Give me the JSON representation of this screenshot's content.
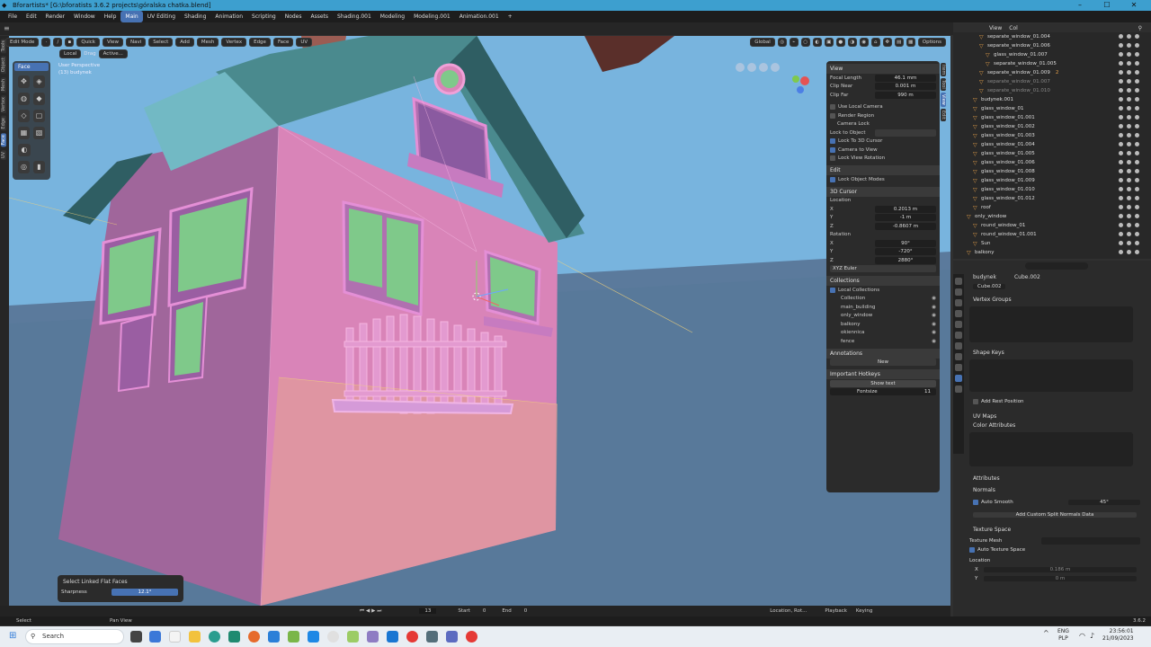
{
  "title_bar": {
    "title": "Bforartists* [G:\\bforatists 3.6.2 projects\\góralska chatka.blend]",
    "minimize": "–",
    "maximize": "☐",
    "close": "✕"
  },
  "menu": {
    "items": [
      "File",
      "Edit",
      "Render",
      "Window",
      "Help"
    ],
    "workspaces": [
      "Main",
      "UV Editing",
      "Shading",
      "Animation",
      "Scripting",
      "Nodes",
      "Assets",
      "Shading.001",
      "Modeling",
      "Modeling.001",
      "Animation.001"
    ],
    "active_workspace": "Main",
    "add_tab": "+"
  },
  "viewport_header": {
    "mode": "Edit Mode",
    "transform_space": "Local",
    "drag": "Drag",
    "active": "Active...",
    "menus": [
      "Quick",
      "View",
      "Navi",
      "Select",
      "Add",
      "Mesh",
      "Vertex",
      "Edge",
      "Face",
      "UV"
    ],
    "orientation": "Global",
    "options": "Options"
  },
  "viewport": {
    "perspective": "User Perspective",
    "object_label": "(13) budynek"
  },
  "left_tabs": [
    "Tools",
    "Object",
    "Mesh",
    "Vertex",
    "Edge",
    "Face",
    "UV"
  ],
  "active_left_tab": "Face",
  "toolbar": {
    "header": "Face"
  },
  "sidebar": {
    "view_header": "View",
    "focal_length_label": "Focal Length",
    "focal_length": "46.1 mm",
    "clip_near_label": "Clip Near",
    "clip_near": "0.001 m",
    "clip_far_label": "Clip Far",
    "clip_far": "990 m",
    "use_local_camera": "Use Local Camera",
    "render_region": "Render Region",
    "camera_lock": "Camera Lock",
    "lock_to_object": "Lock to Object",
    "lock_3d_cursor": "Lock To 3D Cursor",
    "camera_to_view": "Camera to View",
    "lock_view_rotation": "Lock View Rotation",
    "edit_header": "Edit",
    "lock_object_modes": "Lock Object Modes",
    "cursor_header": "3D Cursor",
    "location_label": "Location",
    "loc": [
      {
        "axis": "X",
        "value": "0.2013 m"
      },
      {
        "axis": "Y",
        "value": "-1 m"
      },
      {
        "axis": "Z",
        "value": "-0.8607 m"
      }
    ],
    "rotation_label": "Rotation",
    "rot": [
      {
        "axis": "X",
        "value": "90°"
      },
      {
        "axis": "Y",
        "value": "-720°"
      },
      {
        "axis": "Z",
        "value": "2880°"
      }
    ],
    "rotation_mode": "XYZ Euler",
    "collections_header": "Collections",
    "local_collections": "Local Collections",
    "collections": [
      "Collection",
      "main_building",
      "only_window",
      "balkony",
      "okiennica",
      "fence"
    ],
    "annotations_header": "Annotations",
    "annotations_new": "New",
    "hotkeys_header": "Important Hotkeys",
    "show_text": "Show text",
    "fontsize_label": "Fontsize",
    "fontsize": "11"
  },
  "right_tabs": [
    "Item",
    "Tool",
    "View",
    "Edit"
  ],
  "active_right_tab": "View",
  "outliner": {
    "header_view": "View",
    "header_col": "Col",
    "rows": [
      {
        "indent": 3,
        "name": "separate_window_01.004",
        "dim": false
      },
      {
        "indent": 3,
        "name": "separate_window_01.006",
        "dim": false
      },
      {
        "indent": 4,
        "name": "glass_window_01.007",
        "dim": false
      },
      {
        "indent": 4,
        "name": "separate_window_01.005",
        "dim": false
      },
      {
        "indent": 3,
        "name": "separate_window_01.009",
        "dim": false,
        "badge": "2"
      },
      {
        "indent": 3,
        "name": "separate_window_01.007",
        "dim": true
      },
      {
        "indent": 3,
        "name": "separate_window_01.010",
        "dim": true
      },
      {
        "indent": 2,
        "name": "budynek.001",
        "dim": false
      },
      {
        "indent": 2,
        "name": "glass_window_01",
        "dim": false
      },
      {
        "indent": 2,
        "name": "glass_window_01.001",
        "dim": false
      },
      {
        "indent": 2,
        "name": "glass_window_01.002",
        "dim": false
      },
      {
        "indent": 2,
        "name": "glass_window_01.003",
        "dim": false
      },
      {
        "indent": 2,
        "name": "glass_window_01.004",
        "dim": false
      },
      {
        "indent": 2,
        "name": "glass_window_01.005",
        "dim": false
      },
      {
        "indent": 2,
        "name": "glass_window_01.006",
        "dim": false
      },
      {
        "indent": 2,
        "name": "glass_window_01.008",
        "dim": false
      },
      {
        "indent": 2,
        "name": "glass_window_01.009",
        "dim": false
      },
      {
        "indent": 2,
        "name": "glass_window_01.010",
        "dim": false
      },
      {
        "indent": 2,
        "name": "glass_window_01.012",
        "dim": false
      },
      {
        "indent": 2,
        "name": "roof",
        "dim": false
      },
      {
        "indent": 1,
        "name": "only_window",
        "dim": false
      },
      {
        "indent": 2,
        "name": "round_window_01",
        "dim": false
      },
      {
        "indent": 2,
        "name": "round_window_01.001",
        "dim": false
      },
      {
        "indent": 2,
        "name": "Sun",
        "dim": false
      },
      {
        "indent": 1,
        "name": "balkony",
        "dim": false
      }
    ]
  },
  "properties": {
    "object": "budynek",
    "mesh": "Cube.002",
    "datablock": "Cube.002",
    "vertex_groups": "Vertex Groups",
    "shape_keys": "Shape Keys",
    "add_rest_position": "Add Rest Position",
    "uv_maps": "UV Maps",
    "color_attributes": "Color Attributes",
    "attributes": "Attributes",
    "normals": "Normals",
    "auto_smooth": "Auto Smooth",
    "auto_smooth_angle": "45°",
    "add_split_normals": "Add Custom Split Normals Data",
    "texture_space": "Texture Space",
    "texture_mesh": "Texture Mesh",
    "auto_texture_space": "Auto Texture Space",
    "location_label": "Location",
    "loc_x_axis": "X",
    "loc_x": "0.186 m",
    "loc_y_axis": "Y",
    "loc_y": "0 m"
  },
  "operator_panel": {
    "title": "Select Linked Flat Faces",
    "sharpness_label": "Sharpness",
    "sharpness": "12.1°"
  },
  "timeline": {
    "frame": "13",
    "start_label": "Start",
    "start": "0",
    "end_label": "End",
    "end": "0",
    "keyset": "Location, Rot...",
    "playback": "Playback",
    "keying": "Keying"
  },
  "status": {
    "left": "Select",
    "middle": "Pan View",
    "version": "3.6.2"
  },
  "taskbar": {
    "search": "Search",
    "lang1": "ENG",
    "lang2": "PLP",
    "time": "23:56:01",
    "date": "21/09/2023"
  },
  "colors": {
    "accent": "#4772b3",
    "title_bar": "#3d9fcf",
    "house": "#d87fb5",
    "sky": "#78b4de",
    "glass": "#7fc98a"
  }
}
